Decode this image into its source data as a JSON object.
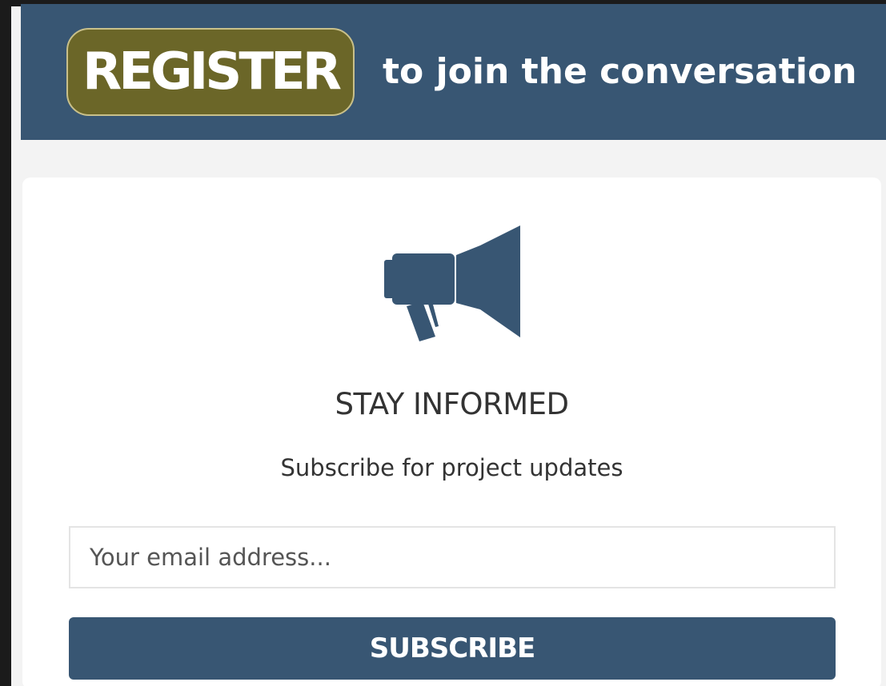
{
  "banner": {
    "register_label": "REGISTER",
    "tagline": "to join the conversation"
  },
  "signup_card": {
    "icon": "megaphone-icon",
    "title": "STAY INFORMED",
    "subtitle": "Subscribe for project updates",
    "email_value": "",
    "email_placeholder": "Your email address...",
    "subscribe_label": "SUBSCRIBE"
  },
  "colors": {
    "banner_bg": "#385673",
    "register_bg": "#6b6628",
    "button_bg": "#385673",
    "icon_color": "#385673"
  }
}
